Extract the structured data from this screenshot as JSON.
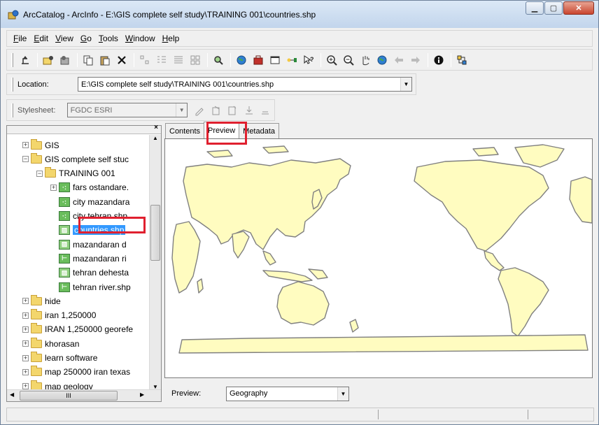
{
  "window": {
    "title": "ArcCatalog - ArcInfo - E:\\GIS complete self study\\TRAINING 001\\countries.shp"
  },
  "menu": [
    {
      "label": "File",
      "key": "F"
    },
    {
      "label": "Edit",
      "key": "E"
    },
    {
      "label": "View",
      "key": "V"
    },
    {
      "label": "Go",
      "key": "G"
    },
    {
      "label": "Tools",
      "key": "T"
    },
    {
      "label": "Window",
      "key": "W"
    },
    {
      "label": "Help",
      "key": "H"
    }
  ],
  "location": {
    "label": "Location:",
    "value": "E:\\GIS complete self study\\TRAINING 001\\countries.shp"
  },
  "stylesheet": {
    "label": "Stylesheet:",
    "value": "FGDC ESRI"
  },
  "tree": {
    "items": [
      {
        "label": "GIS",
        "type": "folder",
        "expander": "+"
      },
      {
        "label": "GIS complete self stuc",
        "type": "folder",
        "expander": "−"
      },
      {
        "label": "TRAINING 001",
        "type": "folder",
        "expander": "−"
      },
      {
        "label": "fars ostandare.",
        "type": "point",
        "expander": "+"
      },
      {
        "label": "city mazandara",
        "type": "point"
      },
      {
        "label": "city tehran.shp",
        "type": "point"
      },
      {
        "label": "countries.shp",
        "type": "polygon",
        "selected": true
      },
      {
        "label": "mazandaran d",
        "type": "polygon"
      },
      {
        "label": "mazandaran ri",
        "type": "line"
      },
      {
        "label": "tehran dehesta",
        "type": "polygon"
      },
      {
        "label": "tehran river.shp",
        "type": "line"
      },
      {
        "label": "hide",
        "type": "folder",
        "expander": "+"
      },
      {
        "label": "iran 1,250000",
        "type": "folder",
        "expander": "+"
      },
      {
        "label": "IRAN 1,250000 georefe",
        "type": "folder",
        "expander": "+"
      },
      {
        "label": "khorasan",
        "type": "folder",
        "expander": "+"
      },
      {
        "label": "learn software",
        "type": "folder",
        "expander": "+"
      },
      {
        "label": "map 250000 iran texas",
        "type": "folder",
        "expander": "+"
      },
      {
        "label": "map geology",
        "type": "folder",
        "expander": "+"
      }
    ],
    "scroll_mark": "III"
  },
  "tabs": [
    {
      "label": "Contents"
    },
    {
      "label": "Preview",
      "active": true
    },
    {
      "label": "Metadata"
    }
  ],
  "preview": {
    "label": "Preview:",
    "value": "Geography"
  },
  "colors": {
    "highlight": "#e0202f",
    "selection": "#3399ff",
    "land": "#fffcc0",
    "outline": "#808080"
  }
}
